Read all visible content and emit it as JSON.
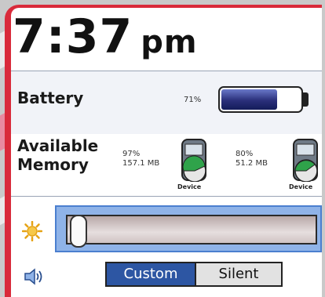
{
  "clock": {
    "time": "7:37",
    "ampm": "pm"
  },
  "battery": {
    "label": "Battery",
    "percent_text": "71%",
    "level": 0.71
  },
  "memory": {
    "label_line1": "Available",
    "label_line2": "Memory",
    "devices": [
      {
        "percent": "97%",
        "size": "157.1 MB",
        "name": "Device"
      },
      {
        "percent": "80%",
        "size": "51.2 MB",
        "name": "Device"
      }
    ]
  },
  "brightness": {
    "icon": "sun-icon",
    "level": 0.05
  },
  "sound": {
    "icon": "speaker-icon",
    "options": [
      "Custom",
      "Silent"
    ],
    "selected": "Custom"
  },
  "colors": {
    "frame": "#d92a3a",
    "selected_segment": "#2d56a3",
    "slider_focus": "#8fb3e8",
    "battery_fill": "#2a2f7a"
  }
}
